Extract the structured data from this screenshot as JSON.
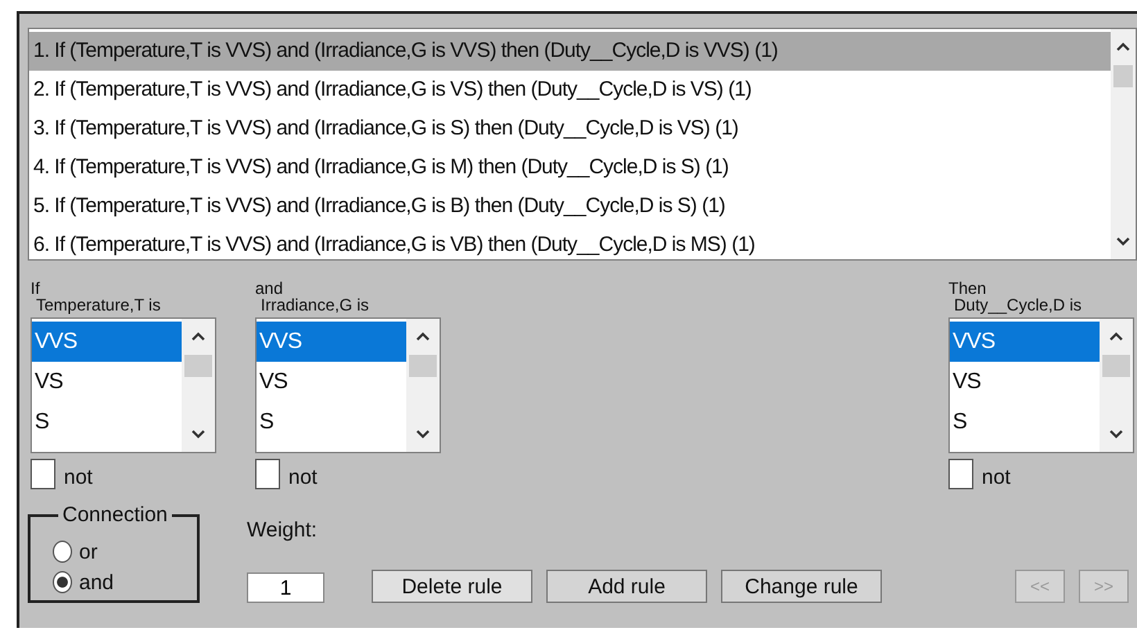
{
  "rules": [
    {
      "text": "1. If (Temperature,T is VVS) and (Irradiance,G is VVS) then (Duty__Cycle,D is VVS) (1)",
      "selected": true
    },
    {
      "text": "2. If (Temperature,T is VVS) and (Irradiance,G is VS) then (Duty__Cycle,D is VS) (1)",
      "selected": false
    },
    {
      "text": "3. If (Temperature,T is VVS) and (Irradiance,G is S) then (Duty__Cycle,D is VS) (1)",
      "selected": false
    },
    {
      "text": "4. If (Temperature,T is VVS) and (Irradiance,G is M) then (Duty__Cycle,D is S) (1)",
      "selected": false
    },
    {
      "text": "5. If (Temperature,T is VVS) and (Irradiance,G is B) then (Duty__Cycle,D is S) (1)",
      "selected": false
    },
    {
      "text": "6. If (Temperature,T is VVS) and (Irradiance,G is VB) then (Duty__Cycle,D is MS) (1)",
      "selected": false
    }
  ],
  "inputs": [
    {
      "keyword": "If",
      "label": "Temperature,T is",
      "items": [
        {
          "text": "VVS",
          "selected": true
        },
        {
          "text": "VS",
          "selected": false
        },
        {
          "text": "S",
          "selected": false
        }
      ],
      "not": {
        "label": "not",
        "checked": false
      }
    },
    {
      "keyword": "and",
      "label": "Irradiance,G is",
      "items": [
        {
          "text": "VVS",
          "selected": true
        },
        {
          "text": "VS",
          "selected": false
        },
        {
          "text": "S",
          "selected": false
        }
      ],
      "not": {
        "label": "not",
        "checked": false
      }
    }
  ],
  "output": {
    "keyword": "Then",
    "label": "Duty__Cycle,D is",
    "items": [
      {
        "text": "VVS",
        "selected": true
      },
      {
        "text": "VS",
        "selected": false
      },
      {
        "text": "S",
        "selected": false
      }
    ],
    "not": {
      "label": "not",
      "checked": false
    }
  },
  "connection": {
    "title": "Connection",
    "options": [
      {
        "label": "or",
        "selected": false
      },
      {
        "label": "and",
        "selected": true
      }
    ]
  },
  "weight": {
    "label": "Weight:",
    "value": "1"
  },
  "buttons": [
    {
      "label": "Delete rule",
      "disabled": false
    },
    {
      "label": "Add rule",
      "disabled": false
    },
    {
      "label": "Change rule",
      "disabled": false
    }
  ],
  "nav": [
    {
      "label": "<<",
      "disabled": true
    },
    {
      "label": ">>",
      "disabled": true
    }
  ]
}
